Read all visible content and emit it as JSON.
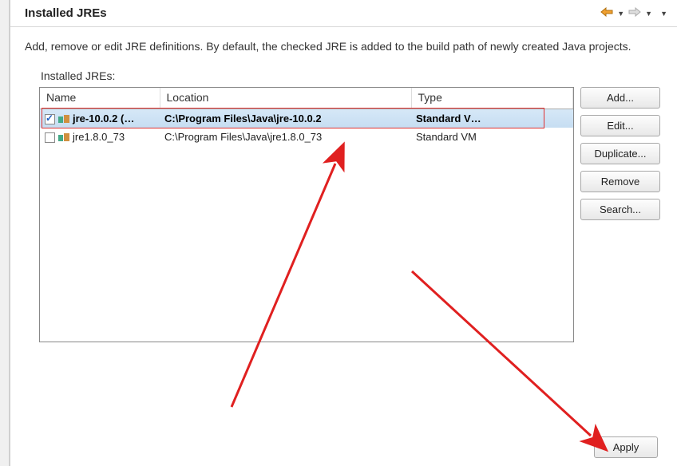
{
  "header": {
    "title": "Installed JREs"
  },
  "description": "Add, remove or edit JRE definitions. By default, the checked JRE is added to the build path of newly created Java projects.",
  "list_label": "Installed JREs:",
  "columns": {
    "name": "Name",
    "location": "Location",
    "type": "Type"
  },
  "rows": [
    {
      "checked": true,
      "selected": true,
      "name": "jre-10.0.2 (…",
      "location": "C:\\Program Files\\Java\\jre-10.0.2",
      "type": "Standard V…"
    },
    {
      "checked": false,
      "selected": false,
      "name": "jre1.8.0_73",
      "location": "C:\\Program Files\\Java\\jre1.8.0_73",
      "type": "Standard VM"
    }
  ],
  "buttons": {
    "add": "Add...",
    "edit": "Edit...",
    "duplicate": "Duplicate...",
    "remove": "Remove",
    "search": "Search...",
    "apply": "Apply"
  }
}
